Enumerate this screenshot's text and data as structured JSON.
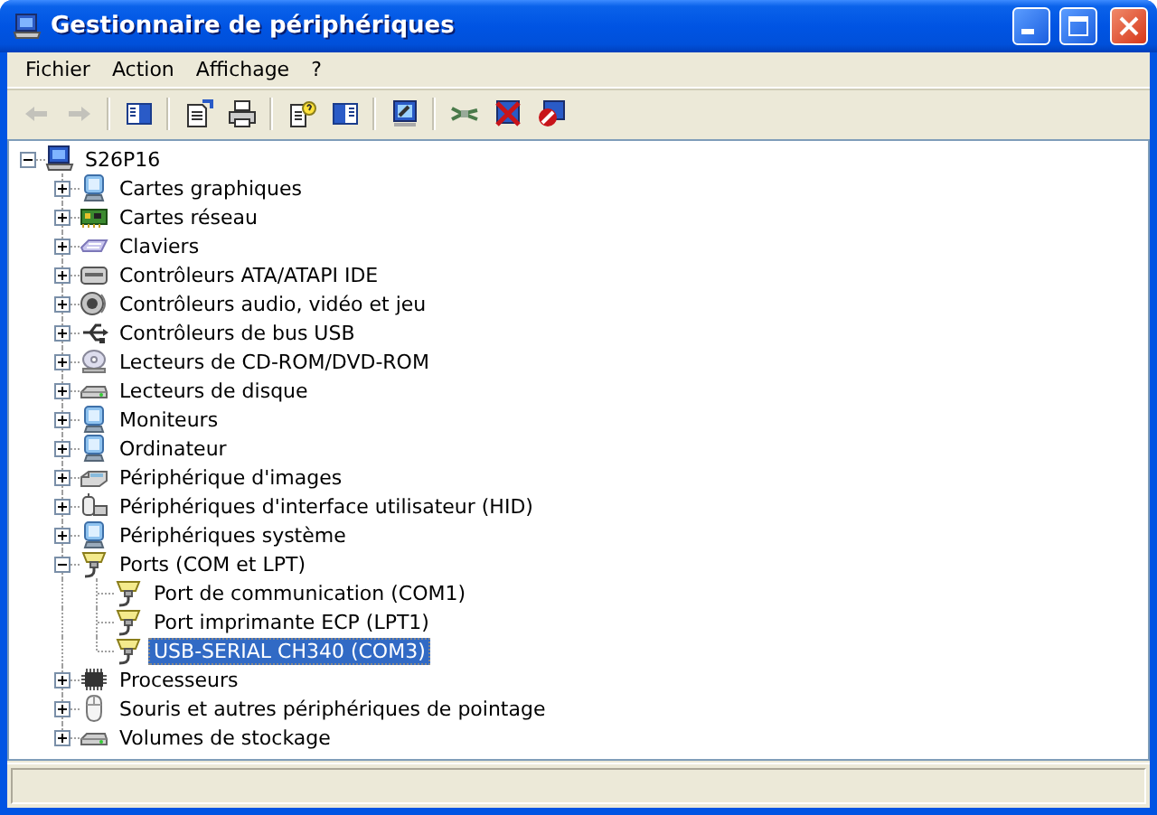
{
  "window": {
    "title": "Gestionnaire de périphériques"
  },
  "menu": [
    "Fichier",
    "Action",
    "Affichage",
    "?"
  ],
  "toolbar": [
    {
      "kind": "back",
      "disabled": true
    },
    {
      "kind": "forward",
      "disabled": true
    },
    {
      "kind": "separator"
    },
    {
      "kind": "console-tree",
      "disabled": false
    },
    {
      "kind": "separator"
    },
    {
      "kind": "properties",
      "disabled": false
    },
    {
      "kind": "print",
      "disabled": false
    },
    {
      "kind": "separator"
    },
    {
      "kind": "help",
      "disabled": false
    },
    {
      "kind": "action-pane",
      "disabled": false
    },
    {
      "kind": "separator"
    },
    {
      "kind": "scan",
      "disabled": false
    },
    {
      "kind": "separator"
    },
    {
      "kind": "update",
      "disabled": false
    },
    {
      "kind": "uninstall",
      "disabled": false
    },
    {
      "kind": "disable",
      "disabled": false
    }
  ],
  "tree": {
    "label": "S26P16",
    "kind": "computer",
    "expanded": true,
    "selected": false,
    "children": [
      {
        "label": "Cartes graphiques",
        "kind": "monitor",
        "expanded": false,
        "selected": false
      },
      {
        "label": "Cartes réseau",
        "kind": "network",
        "expanded": false,
        "selected": false
      },
      {
        "label": "Claviers",
        "kind": "keyboard",
        "expanded": false,
        "selected": false
      },
      {
        "label": "Contrôleurs ATA/ATAPI IDE",
        "kind": "drive",
        "expanded": false,
        "selected": false
      },
      {
        "label": "Contrôleurs audio, vidéo et jeu",
        "kind": "speaker",
        "expanded": false,
        "selected": false
      },
      {
        "label": "Contrôleurs de bus USB",
        "kind": "usb",
        "expanded": false,
        "selected": false
      },
      {
        "label": "Lecteurs de CD-ROM/DVD-ROM",
        "kind": "cd",
        "expanded": false,
        "selected": false
      },
      {
        "label": "Lecteurs de disque",
        "kind": "disk",
        "expanded": false,
        "selected": false
      },
      {
        "label": "Moniteurs",
        "kind": "monitor",
        "expanded": false,
        "selected": false
      },
      {
        "label": "Ordinateur",
        "kind": "monitor",
        "expanded": false,
        "selected": false
      },
      {
        "label": "Périphérique d'images",
        "kind": "scanner",
        "expanded": false,
        "selected": false
      },
      {
        "label": "Périphériques d'interface utilisateur (HID)",
        "kind": "hid",
        "expanded": false,
        "selected": false
      },
      {
        "label": "Périphériques système",
        "kind": "monitor",
        "expanded": false,
        "selected": false
      },
      {
        "label": "Ports (COM et LPT)",
        "kind": "port",
        "expanded": true,
        "selected": false,
        "children": [
          {
            "label": "Port de communication (COM1)",
            "kind": "port",
            "selected": false
          },
          {
            "label": "Port imprimante ECP (LPT1)",
            "kind": "port",
            "selected": false
          },
          {
            "label": "USB-SERIAL CH340 (COM3)",
            "kind": "port",
            "selected": true
          }
        ]
      },
      {
        "label": "Processeurs",
        "kind": "chip",
        "expanded": false,
        "selected": false
      },
      {
        "label": "Souris et autres périphériques de pointage",
        "kind": "mouse",
        "expanded": false,
        "selected": false
      },
      {
        "label": "Volumes de stockage",
        "kind": "disk",
        "expanded": false,
        "selected": false
      }
    ]
  }
}
